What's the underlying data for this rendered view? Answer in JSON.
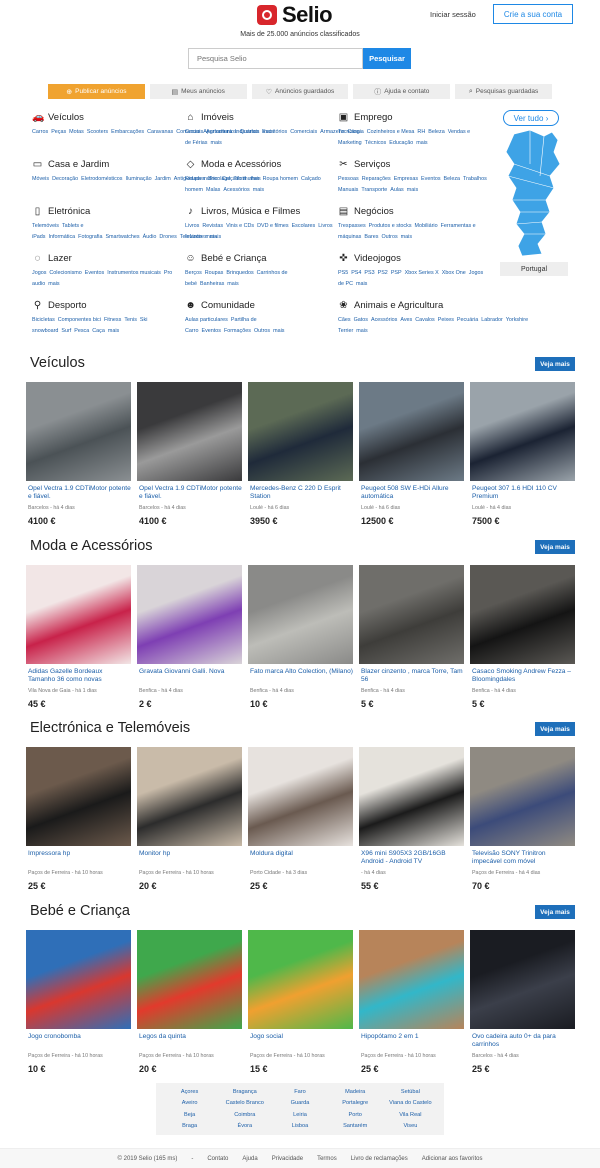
{
  "brand": {
    "name": "Selio",
    "tagline": "Mais de 25.000 anúncios classificados"
  },
  "header": {
    "login": "Iniciar sessão",
    "register": "Crie a sua conta"
  },
  "search": {
    "placeholder": "Pesquisa Selio",
    "button": "Pesquisar"
  },
  "nav": [
    {
      "label": "Publicar anúncios",
      "icon": "plus-circle-icon"
    },
    {
      "label": "Meus anúncios",
      "icon": "list-icon"
    },
    {
      "label": "Anúncios guardados",
      "icon": "heart-icon"
    },
    {
      "label": "Ajuda e contato",
      "icon": "help-icon"
    },
    {
      "label": "Pesquisas guardadas",
      "icon": "search-icon"
    }
  ],
  "categories": [
    {
      "title": "Veículos",
      "icon": "car-icon",
      "glyph": "🚗",
      "links": [
        "Carros",
        "Peças",
        "Motas",
        "Scooters",
        "Embarcações",
        "Caravanas",
        "Comerciais",
        "Agricultura",
        "Industriais",
        "mais"
      ]
    },
    {
      "title": "Imóveis",
      "icon": "house-icon",
      "glyph": "⌂",
      "links": [
        "Casas",
        "Apartamentos",
        "Quartos",
        "Escritórios",
        "Comerciais",
        "Armazens",
        "Casa de Férias",
        "mais"
      ]
    },
    {
      "title": "Emprego",
      "icon": "briefcase-icon",
      "glyph": "▣",
      "links": [
        "Tecnologia",
        "Cozinheiros e Mesa",
        "RH",
        "Beleza",
        "Vendas e Marketing",
        "Técnicos",
        "Educação",
        "mais"
      ]
    },
    {
      "title": "Casa e Jardim",
      "icon": "sofa-icon",
      "glyph": "▭",
      "links": [
        "Móveis",
        "Decoração",
        "Eletrodomésticos",
        "Iluminação",
        "Jardim",
        "Antiguidades",
        "Bricolage",
        "Têxtil",
        "mais"
      ]
    },
    {
      "title": "Moda e Acessórios",
      "icon": "shirt-icon",
      "glyph": "◇",
      "links": [
        "Roupa mulher",
        "Calçado mulher",
        "Roupa homem",
        "Calçado homem",
        "Malas",
        "Acessórios",
        "mais"
      ]
    },
    {
      "title": "Serviços",
      "icon": "tools-icon",
      "glyph": "✂",
      "links": [
        "Pessoas",
        "Reparações",
        "Empresas",
        "Eventos",
        "Beleza",
        "Trabalhos Manuais",
        "Transporte",
        "Aulas",
        "mais"
      ]
    },
    {
      "title": "Eletrónica",
      "icon": "phone-icon",
      "glyph": "▯",
      "links": [
        "Telemóveis",
        "Tablets e iPads",
        "Informática",
        "Fotografia",
        "Smartwatches",
        "Áudio",
        "Drones",
        "Televisores",
        "mais"
      ]
    },
    {
      "title": "Livros, Música e Filmes",
      "icon": "music-icon",
      "glyph": "♪",
      "links": [
        "Livros",
        "Revistas",
        "Vinis e CDs",
        "DVD e filmes",
        "Escolares",
        "Livros Infantis",
        "mais"
      ]
    },
    {
      "title": "Negócios",
      "icon": "store-icon",
      "glyph": "▤",
      "links": [
        "Trespasses",
        "Produtos e stocks",
        "Mobiliário",
        "Ferramentas e máquinas",
        "Bares",
        "Outros",
        "mais"
      ]
    },
    {
      "title": "Lazer",
      "icon": "chat-icon",
      "glyph": "◌",
      "links": [
        "Jogos",
        "Colecionismo",
        "Eventos",
        "Instrumentos musicais",
        "Pro audio",
        "mais"
      ]
    },
    {
      "title": "Bebé e Criança",
      "icon": "baby-icon",
      "glyph": "☺",
      "links": [
        "Berços",
        "Roupas",
        "Brinquedos",
        "Carrinhos de bebé",
        "Banheiras",
        "mais"
      ]
    },
    {
      "title": "Videojogos",
      "icon": "gamepad-icon",
      "glyph": "✜",
      "links": [
        "PS5",
        "PS4",
        "PS3",
        "PS2",
        "PSP",
        "Xbox Series X",
        "Xbox One",
        "Jogos de PC",
        "mais"
      ]
    },
    {
      "title": "Desporto",
      "icon": "bike-icon",
      "glyph": "⚲",
      "links": [
        "Bicicletas",
        "Componentes bici",
        "Fitness",
        "Tenis",
        "Ski snowboard",
        "Surf",
        "Pesca",
        "Caça",
        "mais"
      ]
    },
    {
      "title": "Comunidade",
      "icon": "people-icon",
      "glyph": "☻",
      "links": [
        "Aulas particulares",
        "Partilha de Carro",
        "Eventos",
        "Formações",
        "Outros",
        "mais"
      ]
    },
    {
      "title": "Animais e Agricultura",
      "icon": "paw-icon",
      "glyph": "❀",
      "links": [
        "Cães",
        "Gatos",
        "Acessórios",
        "Aves",
        "Cavalos",
        "Peixes",
        "Pecuária",
        "Labrador",
        "Yorkshire Terrier",
        "mais"
      ]
    }
  ],
  "map": {
    "more": "Ver tudo",
    "country": "Portugal",
    "color": "#3ea3e6"
  },
  "sections": [
    {
      "title": "Veículos",
      "more": "Veja mais",
      "items": [
        {
          "title": "Opel Vectra 1.9 CDTiMotor potente e fiável.",
          "meta": "Barcelos - há 4 dias",
          "price": "4100 €",
          "colors": [
            "#8a8f92",
            "#4b5256"
          ]
        },
        {
          "title": "Opel Vectra 1.9 CDTiMotor potente e fiável.",
          "meta": "Barcelos - há 4 dias",
          "price": "4100 €",
          "colors": [
            "#3a3a3c",
            "#9a9a9a"
          ]
        },
        {
          "title": "Mercedes-Benz C 220 D Esprit Station",
          "meta": "Loulé - há 6 dias",
          "price": "3950 €",
          "colors": [
            "#5c6a55",
            "#1f2a3a"
          ]
        },
        {
          "title": "Peugeot 508 SW E-HDi Allure automática",
          "meta": "Loulé - há 6 dias",
          "price": "12500 €",
          "colors": [
            "#6c7a86",
            "#2b2f35"
          ]
        },
        {
          "title": "Peugeot 307 1.6 HDI 110 CV Premium",
          "meta": "Loulé - há 4 dias",
          "price": "7500 €",
          "colors": [
            "#9aa3aa",
            "#1b2333"
          ]
        }
      ]
    },
    {
      "title": "Moda e Acessórios",
      "more": "Veja mais",
      "items": [
        {
          "title": "Adidas Gazelle Bordeaux Tamanho 36 como novas",
          "meta": "Vila Nova de Gaia - há 1 dias",
          "price": "45 €",
          "colors": [
            "#f2e6e6",
            "#c8224a"
          ]
        },
        {
          "title": "Gravata Giovanni Galli. Nova",
          "meta": "Benfica - há 4 dias",
          "price": "2 €",
          "colors": [
            "#d9d4d8",
            "#7e3fb3"
          ]
        },
        {
          "title": "Fato marca Alto Colection, (Milano)",
          "meta": "Benfica - há 4 dias",
          "price": "10 €",
          "colors": [
            "#8a8a88",
            "#bdbdb8"
          ]
        },
        {
          "title": "Blazer cinzento , marca Torre, Tam 56",
          "meta": "Benfica - há 4 dias",
          "price": "5 €",
          "colors": [
            "#6f6e6a",
            "#3e3d3a"
          ]
        },
        {
          "title": "Casaco Smoking Andrew Fezza – Bloomingdales",
          "meta": "Benfica - há 4 dias",
          "price": "5 €",
          "colors": [
            "#5a5854",
            "#141414"
          ]
        }
      ]
    },
    {
      "title": "Electrónica e Telemóveis",
      "more": "Veja mais",
      "items": [
        {
          "title": "Impressora hp",
          "meta": "Paços de Ferreira - há 10 horas",
          "price": "25 €",
          "colors": [
            "#6c5a4c",
            "#1a1a1a"
          ]
        },
        {
          "title": "Monitor hp",
          "meta": "Paços de Ferreira - há 10 horas",
          "price": "20 €",
          "colors": [
            "#c9bba9",
            "#2c2c2c"
          ]
        },
        {
          "title": "Moldura digital",
          "meta": "Porto Cidade - há 3 dias",
          "price": "25 €",
          "colors": [
            "#e7e2de",
            "#6a5a50"
          ]
        },
        {
          "title": "X96 mini S905X3 2GB/16GB Android - Android TV",
          "meta": "- há 4 dias",
          "price": "55 €",
          "colors": [
            "#e5e2dc",
            "#1b1b1b"
          ]
        },
        {
          "title": "Televisão SONY Trinitron impecável com móvel",
          "meta": "Paços de Ferreira - há 4 dias",
          "price": "70 €",
          "colors": [
            "#8f8a82",
            "#3c4b7a"
          ]
        }
      ]
    },
    {
      "title": "Bebé e Criança",
      "more": "Veja mais",
      "items": [
        {
          "title": "Jogo cronobomba",
          "meta": "Paços de Ferreira - há 10 horas",
          "price": "10 €",
          "colors": [
            "#2f6fb8",
            "#d9372f"
          ]
        },
        {
          "title": "Legos da quinta",
          "meta": "Paços de Ferreira - há 10 horas",
          "price": "20 €",
          "colors": [
            "#3fa84c",
            "#e23a2c"
          ]
        },
        {
          "title": "Jogo social",
          "meta": "Paços de Ferreira - há 10 horas",
          "price": "15 €",
          "colors": [
            "#4fb84a",
            "#f0a030"
          ]
        },
        {
          "title": "Hipopótamo 2 em 1",
          "meta": "Paços de Ferreira - há 10 horas",
          "price": "25 €",
          "colors": [
            "#b7845a",
            "#32b7c9"
          ]
        },
        {
          "title": "Ovo cadeira auto 0+ da para carrinhos",
          "meta": "Barcelos - há 4 dias",
          "price": "25 €",
          "colors": [
            "#1a1c22",
            "#3b3f4a"
          ]
        }
      ]
    }
  ],
  "cities": [
    "Açores",
    "Bragança",
    "Faro",
    "Madeira",
    "Setúbal",
    "Aveiro",
    "Castelo Branco",
    "Guarda",
    "Portalegre",
    "Viana do Castelo",
    "Beja",
    "Coimbra",
    "Leiria",
    "Porto",
    "Vila Real",
    "Braga",
    "Évora",
    "Lisboa",
    "Santarém",
    "Viseu"
  ],
  "footer": [
    "© 2019 Selio (165 ms)",
    "-",
    "Contato",
    "Ajuda",
    "Privacidade",
    "Termos",
    "Livro de reclamações",
    "Adicionar aos favoritos"
  ]
}
